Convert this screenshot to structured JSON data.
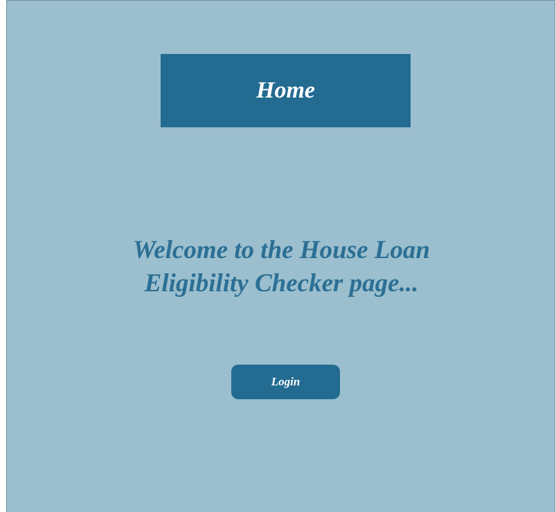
{
  "header": {
    "title": "Home"
  },
  "main": {
    "welcome_line1": "Welcome to the House Loan",
    "welcome_line2": "Eligibility Checker page...",
    "login_label": "Login"
  },
  "colors": {
    "background": "#9bbfce",
    "accent": "#236b91",
    "heading_text": "#2c6f94"
  }
}
